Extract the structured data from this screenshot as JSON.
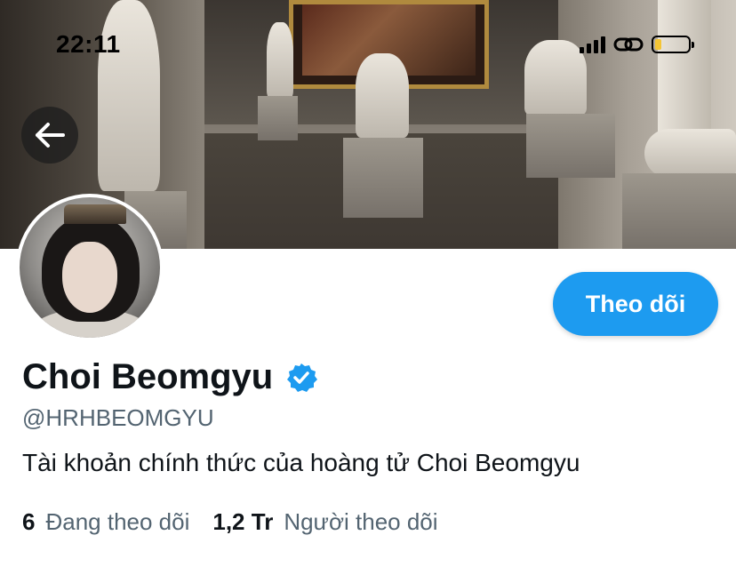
{
  "status_bar": {
    "time": "22:11",
    "battery_level": 0.2,
    "battery_color": "#f4c535"
  },
  "header": {
    "back_icon": "arrow-left-icon",
    "banner_image": "museum-gallery-photo"
  },
  "profile": {
    "avatar_image": "profile-photo",
    "display_name": "Choi Beomgyu",
    "verified_icon": "verified-badge-icon",
    "handle": "@HRHBEOMGYU",
    "bio": "Tài khoản chính thức của hoàng tử Choi Beomgyu",
    "follow_button_label": "Theo dõi",
    "following_count": "6",
    "following_label": "Đang theo dõi",
    "followers_count": "1,2 Tr",
    "followers_label": "Người theo dõi"
  },
  "colors": {
    "accent": "#1d9bf0",
    "text_primary": "#0f1419",
    "text_secondary": "#536471"
  }
}
